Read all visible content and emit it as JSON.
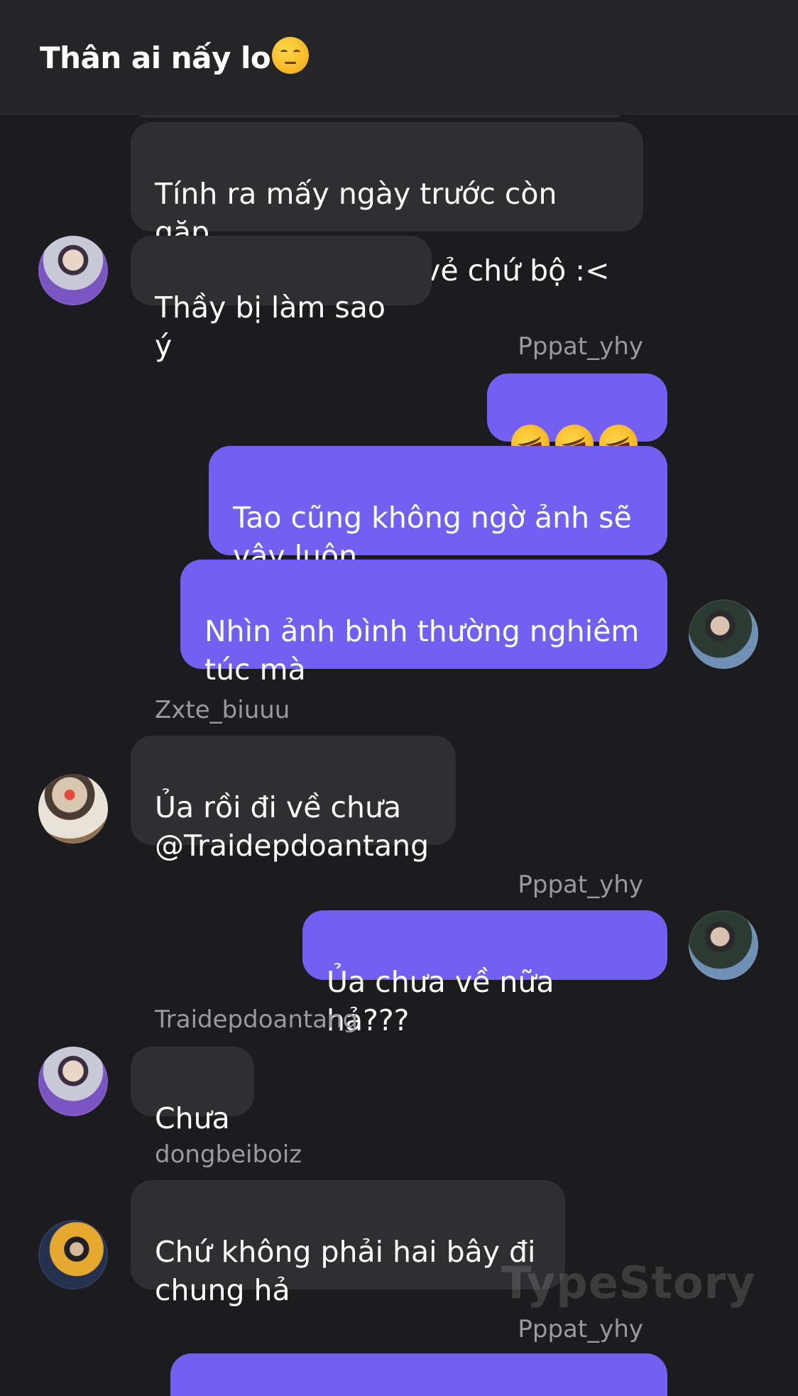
{
  "header": {
    "title": "Thân ai nấy lo",
    "emoji": "unamused-face-icon"
  },
  "messages": [
    {
      "side": "in",
      "text": "Tính ra mấy ngày trước còn gặp\nnhau chào hỏi vui vẻ chứ bộ :<"
    },
    {
      "side": "in",
      "text": "Thầy bị làm sao ý",
      "avatar": "avatar-purple-shirt"
    },
    {
      "side": "out",
      "sender": "Pppat_yhy",
      "emoji": [
        "rolling-laughing-icon",
        "rolling-laughing-icon",
        "rolling-laughing-icon"
      ]
    },
    {
      "side": "out",
      "text": "Tao cũng không ngờ ảnh sẽ\nvậy luôn"
    },
    {
      "side": "out",
      "text": "Nhìn ảnh bình thường nghiêm\ntúc mà",
      "avatar": "avatar-denim"
    },
    {
      "side": "in",
      "sender": "Zxte_biuuu",
      "text": "Ủa rồi đi về chưa\n@Traidepdoantang",
      "avatar": "avatar-apple"
    },
    {
      "side": "out",
      "sender": "Pppat_yhy",
      "text": "Ủa chưa về nữa hả???",
      "avatar": "avatar-denim"
    },
    {
      "side": "in",
      "sender": "Traidepdoantang",
      "text": "Chưa",
      "avatar": "avatar-purple-shirt"
    },
    {
      "side": "in",
      "sender": "dongbeiboiz",
      "text": "Chứ không phải hai bây đi\nchung hả",
      "avatar": "avatar-yellow-jacket"
    },
    {
      "side": "out",
      "sender": "Pppat_yhy"
    }
  ],
  "watermark": "TypeStory",
  "colors": {
    "background": "#1c1c1e",
    "header": "#252527",
    "incoming_bubble": "#2f2f31",
    "outgoing_bubble": "#7360f2",
    "sender_name": "#9a9a9e"
  }
}
